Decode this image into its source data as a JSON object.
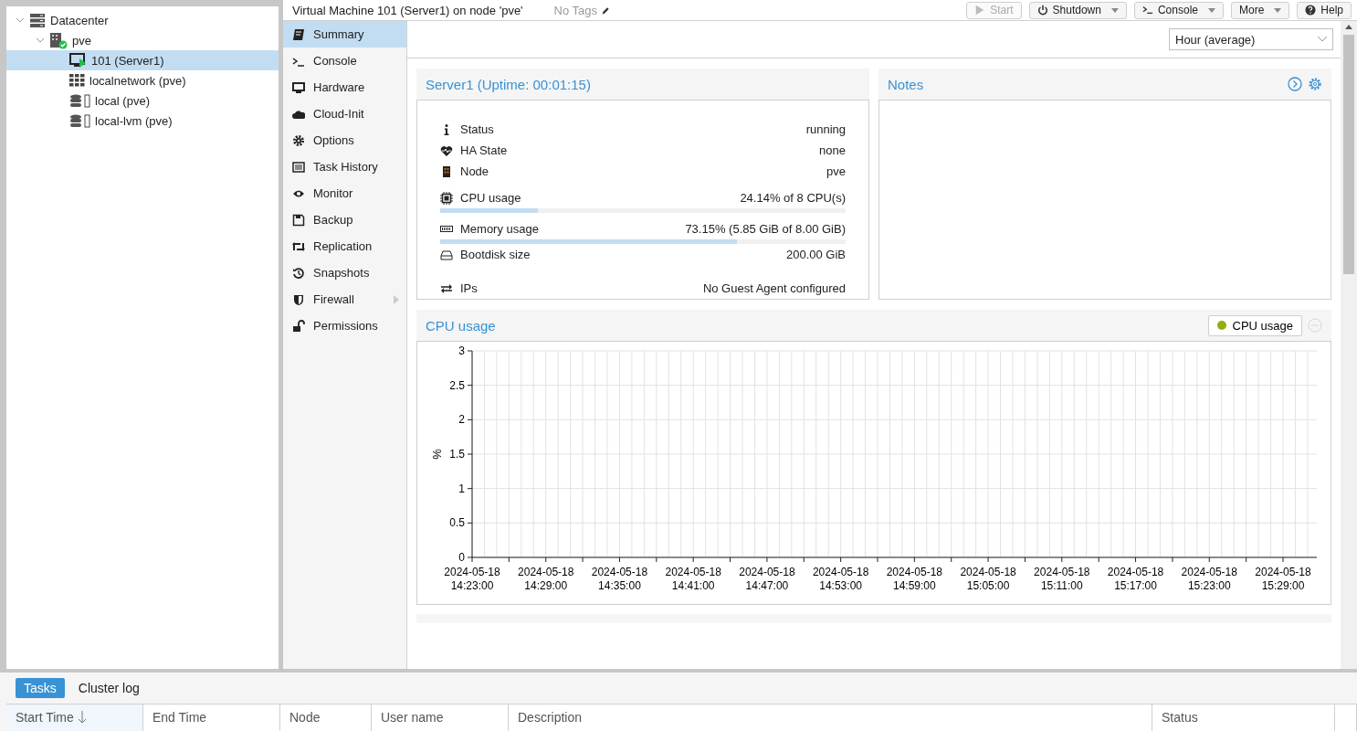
{
  "toolbar": {
    "title": "Virtual Machine 101 (Server1) on node 'pve'",
    "tags": "No Tags",
    "buttons": [
      {
        "label": "Start",
        "disabled": true,
        "dropdown": false,
        "kind": "start"
      },
      {
        "label": "Shutdown",
        "disabled": false,
        "dropdown": true,
        "kind": "power"
      },
      {
        "label": "Console",
        "disabled": false,
        "dropdown": true,
        "kind": "console"
      },
      {
        "label": "More",
        "disabled": false,
        "dropdown": true,
        "kind": "none"
      },
      {
        "label": "Help",
        "disabled": false,
        "dropdown": false,
        "kind": "help"
      }
    ]
  },
  "tree": [
    {
      "label": "Datacenter",
      "kind": "datacenter",
      "expanded": true,
      "selected": false,
      "children": [
        {
          "label": "pve",
          "kind": "node",
          "expanded": true,
          "selected": false,
          "children": [
            {
              "label": "101 (Server1)",
              "kind": "vm",
              "selected": true
            },
            {
              "label": "localnetwork (pve)",
              "kind": "network",
              "selected": false
            },
            {
              "label": "local (pve)",
              "kind": "storage",
              "selected": false
            },
            {
              "label": "local-lvm (pve)",
              "kind": "storage",
              "selected": false
            }
          ]
        }
      ]
    }
  ],
  "menu": [
    {
      "label": "Summary",
      "selected": true,
      "submenu": false
    },
    {
      "label": "Console",
      "selected": false,
      "submenu": false
    },
    {
      "label": "Hardware",
      "selected": false,
      "submenu": false
    },
    {
      "label": "Cloud-Init",
      "selected": false,
      "submenu": false
    },
    {
      "label": "Options",
      "selected": false,
      "submenu": false
    },
    {
      "label": "Task History",
      "selected": false,
      "submenu": false
    },
    {
      "label": "Monitor",
      "selected": false,
      "submenu": false
    },
    {
      "label": "Backup",
      "selected": false,
      "submenu": false
    },
    {
      "label": "Replication",
      "selected": false,
      "submenu": false
    },
    {
      "label": "Snapshots",
      "selected": false,
      "submenu": false
    },
    {
      "label": "Firewall",
      "selected": false,
      "submenu": true
    },
    {
      "label": "Permissions",
      "selected": false,
      "submenu": false
    }
  ],
  "timeframe": {
    "value": "Hour (average)"
  },
  "status_panel": {
    "title": "Server1 (Uptime: 00:01:15)",
    "rows": [
      {
        "kind": "text",
        "label": "Status",
        "value": "running"
      },
      {
        "kind": "text",
        "label": "HA State",
        "value": "none"
      },
      {
        "kind": "text",
        "label": "Node",
        "value": "pve"
      },
      {
        "kind": "meter",
        "label": "CPU usage",
        "value": "24.14% of 8 CPU(s)",
        "level": 0.2414
      },
      {
        "kind": "meter",
        "label": "Memory usage",
        "value": "73.15% (5.85 GiB of 8.00 GiB)",
        "level": 0.7315
      },
      {
        "kind": "text",
        "label": "Bootdisk size",
        "value": "200.00 GiB"
      },
      {
        "kind": "text",
        "label": "IPs",
        "value": "No Guest Agent configured"
      }
    ]
  },
  "notes_panel": {
    "title": "Notes"
  },
  "cpu_panel": {
    "title": "CPU usage",
    "chart_data": {
      "type": "line",
      "grid": true,
      "ylabel": "%",
      "ylim": [
        0,
        3
      ],
      "yticks": [
        0,
        0.5,
        1,
        1.5,
        2,
        2.5,
        3
      ],
      "categories": [
        "2024-05-18 14:23:00",
        "2024-05-18 14:29:00",
        "2024-05-18 14:35:00",
        "2024-05-18 14:41:00",
        "2024-05-18 14:47:00",
        "2024-05-18 14:53:00",
        "2024-05-18 14:59:00",
        "2024-05-18 15:05:00",
        "2024-05-18 15:11:00",
        "2024-05-18 15:17:00",
        "2024-05-18 15:23:00",
        "2024-05-18 15:29:00"
      ],
      "series": [
        {
          "name": "CPU usage",
          "color": "#94ae0a",
          "values": [
            null,
            null,
            null,
            null,
            null,
            null,
            null,
            null,
            null,
            null,
            null,
            null
          ]
        }
      ]
    }
  },
  "bottom": {
    "tabs": [
      {
        "label": "Tasks",
        "selected": true
      },
      {
        "label": "Cluster log",
        "selected": false
      }
    ],
    "columns": [
      {
        "label": "Start Time",
        "sorted": true
      },
      {
        "label": "End Time",
        "sorted": false
      },
      {
        "label": "Node",
        "sorted": false
      },
      {
        "label": "User name",
        "sorted": false
      },
      {
        "label": "Description",
        "sorted": false
      },
      {
        "label": "Status",
        "sorted": false
      }
    ]
  }
}
